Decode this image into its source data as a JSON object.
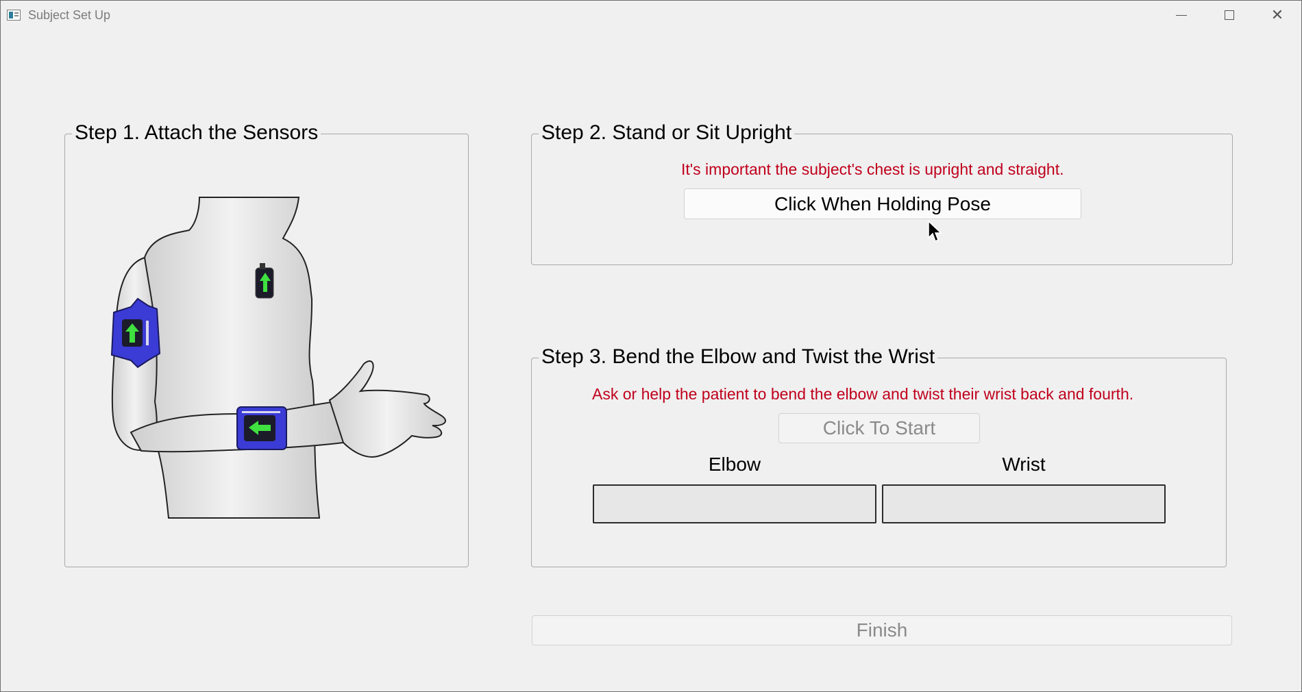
{
  "window": {
    "title": "Subject Set Up",
    "icons": {
      "app": "app-window-icon",
      "minimize": "minimize-icon",
      "maximize": "maximize-icon",
      "close": "close-icon"
    }
  },
  "step1": {
    "title": "Step 1. Attach the Sensors",
    "image": "torso-with-arm-sensors-illustration"
  },
  "step2": {
    "title": "Step 2. Stand or Sit Upright",
    "instruction": "It's important the subject's chest is upright and straight.",
    "button_label": "Click When Holding Pose"
  },
  "step3": {
    "title": "Step 3. Bend the Elbow and Twist the Wrist",
    "instruction": "Ask or help the patient to bend the elbow and twist their wrist back and fourth.",
    "button_label": "Click To Start",
    "elbow_label": "Elbow",
    "wrist_label": "Wrist",
    "elbow_progress": 0,
    "wrist_progress": 0
  },
  "finish_label": "Finish",
  "colors": {
    "warning": "#c0001c",
    "sensor": "#3b3bd6",
    "arrow": "#3fe03f"
  }
}
